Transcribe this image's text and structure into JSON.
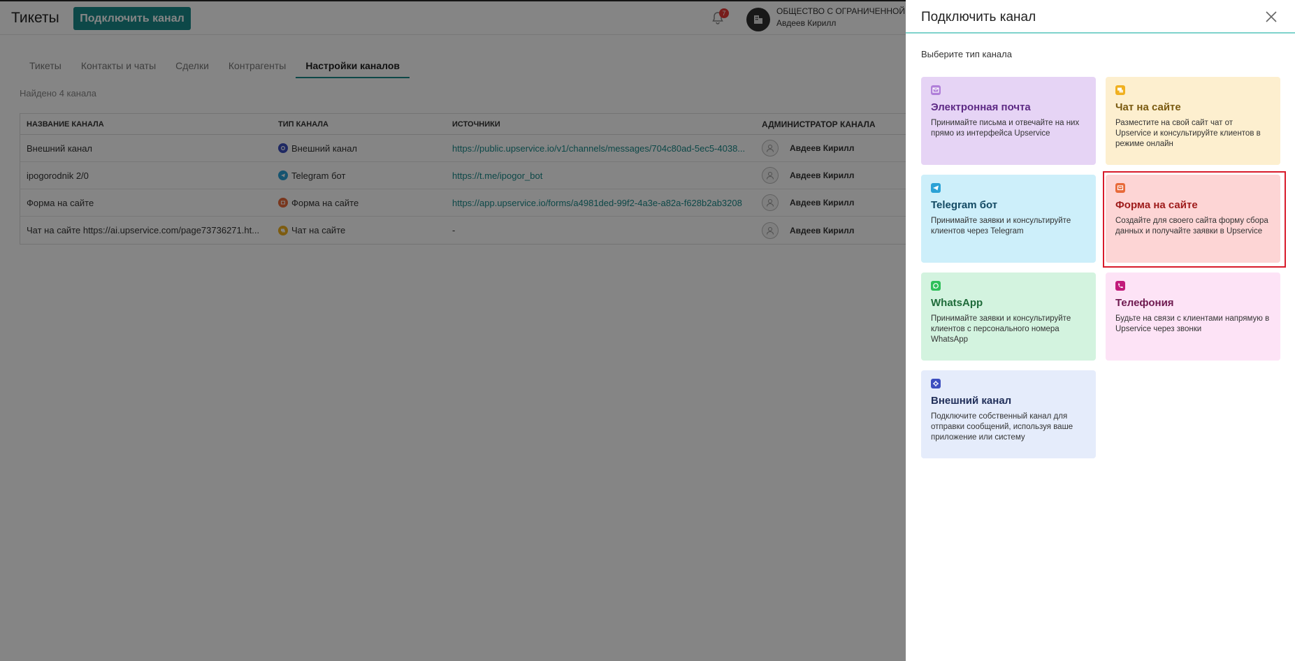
{
  "header": {
    "app_title": "Тикеты",
    "connect_button": "Подключить канал",
    "notification_count": "7",
    "org_name": "ОБЩЕСТВО С ОГРАНИЧЕННОЙ ОТВ",
    "user_name": "Авдеев Кирилл"
  },
  "tabs": [
    {
      "label": "Тикеты",
      "active": false
    },
    {
      "label": "Контакты и чаты",
      "active": false
    },
    {
      "label": "Сделки",
      "active": false
    },
    {
      "label": "Контрагенты",
      "active": false
    },
    {
      "label": "Настройки каналов",
      "active": true
    }
  ],
  "found_text": "Найдено 4 канала",
  "table": {
    "columns": [
      "НАЗВАНИЕ КАНАЛА",
      "ТИП КАНАЛА",
      "ИСТОЧНИКИ",
      "АДМИНИСТРАТОР КАНАЛА"
    ],
    "rows": [
      {
        "name": "Внешний канал",
        "type": "Внешний канал",
        "type_icon": "external-channel-icon",
        "source": "https://public.upservice.io/v1/channels/messages/704c80ad-5ec5-4038...",
        "admin": "Авдеев Кирилл"
      },
      {
        "name": "ipogorodnik 2/0",
        "type": "Telegram бот",
        "type_icon": "telegram-icon",
        "source": "https://t.me/ipogor_bot",
        "admin": "Авдеев Кирилл"
      },
      {
        "name": "Форма на сайте",
        "type": "Форма на сайте",
        "type_icon": "web-form-icon",
        "source": "https://app.upservice.io/forms/a4981ded-99f2-4a3e-a82a-f628b2ab3208",
        "admin": "Авдеев Кирилл"
      },
      {
        "name": "Чат на сайте https://ai.upservice.com/page73736271.ht...",
        "type": "Чат на сайте",
        "type_icon": "site-chat-icon",
        "source": "-",
        "admin": "Авдеев Кирилл"
      }
    ]
  },
  "panel": {
    "title": "Подключить канал",
    "subtitle": "Выберите тип канала",
    "cards": [
      {
        "title": "Электронная почта",
        "desc": "Принимайте письма и отвечайте на них прямо из интерфейса Upservice",
        "icon": "email-icon",
        "bg": "#e6d4f5",
        "fg": "#5e2a85",
        "icon_color": "#b07fd9"
      },
      {
        "title": "Чат на сайте",
        "desc": "Разместите на свой сайт чат от Upservice и консультируйте клиентов в режиме онлайн",
        "icon": "site-chat-icon",
        "bg": "#fdefcf",
        "fg": "#7a5a10",
        "icon_color": "#f0b020"
      },
      {
        "title": "Telegram бот",
        "desc": "Принимайте заявки и консультируйте клиентов через Telegram",
        "icon": "telegram-icon",
        "bg": "#cdeffa",
        "fg": "#134a63",
        "icon_color": "#2ba2d6"
      },
      {
        "title": "Форма на сайте",
        "desc": "Создайте для своего сайта форму сбора данных и получайте заявки в Upservice",
        "icon": "web-form-icon",
        "bg": "#fdd5d5",
        "fg": "#9e1b1b",
        "icon_color": "#e86a3a"
      },
      {
        "title": "WhatsApp",
        "desc": "Принимайте заявки и консультируйте клиентов с персонального номера WhatsApp",
        "icon": "whatsapp-icon",
        "bg": "#d3f3df",
        "fg": "#1f6b3a",
        "icon_color": "#2fbf5a"
      },
      {
        "title": "Телефония",
        "desc": "Будьте на связи с клиентами напрямую в Upservice через звонки",
        "icon": "phone-icon",
        "bg": "#fde3f6",
        "fg": "#6e1a4f",
        "icon_color": "#c21a7a"
      },
      {
        "title": "Внешний канал",
        "desc": "Подключите собственный канал для отправки сообщений, используя ваше приложение или систему",
        "icon": "external-channel-icon",
        "bg": "#e5ecfb",
        "fg": "#22305a",
        "icon_color": "#3d4fbf"
      }
    ]
  }
}
